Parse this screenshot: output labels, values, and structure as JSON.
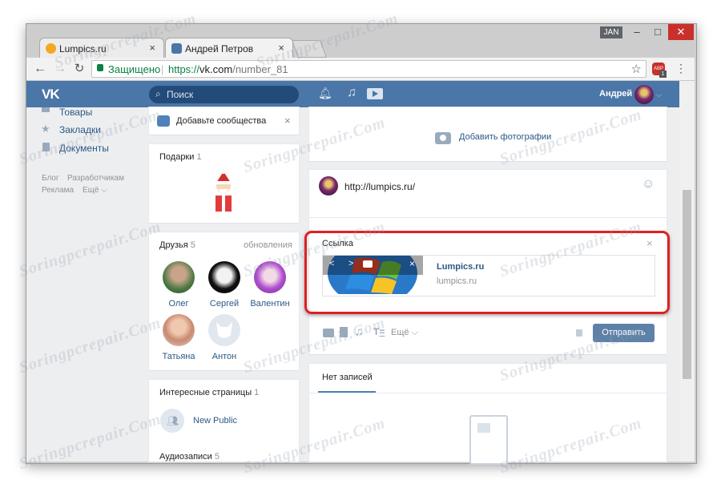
{
  "browser": {
    "tabs": [
      {
        "title": "Lumpics.ru",
        "close": "×"
      },
      {
        "title": "Андрей Петров",
        "close": "×"
      }
    ],
    "user_chip": "JAN",
    "window_controls": {
      "minimize": "–",
      "maximize": "□",
      "close": "✕"
    },
    "secure_label": "Защищено",
    "url_scheme": "https://",
    "url_host": "vk.com",
    "url_path": "/number_81",
    "ext_badge": "1",
    "ext_label": "ABP"
  },
  "vk": {
    "logo": "VK",
    "search_placeholder": "Поиск",
    "user_name": "Андрей",
    "left_menu": [
      {
        "label": "Товары"
      },
      {
        "label": "Закладки"
      },
      {
        "label": "Документы"
      }
    ],
    "footer_links": {
      "blog": "Блог",
      "dev": "Разработчикам",
      "ads": "Реклама",
      "more": "Ещё"
    },
    "add_communities": "Добавьте сообщества",
    "gifts": {
      "title": "Подарки",
      "count": "1"
    },
    "friends": {
      "title": "Друзья",
      "count": "5",
      "updates": "обновления",
      "list": [
        {
          "name": "Олег"
        },
        {
          "name": "Сергей"
        },
        {
          "name": "Валентин"
        },
        {
          "name": "Татьяна"
        },
        {
          "name": "Антон"
        }
      ]
    },
    "interesting": {
      "title": "Интересные страницы",
      "count": "1",
      "item": "New Public"
    },
    "audio": {
      "title": "Аудиозаписи",
      "count": "5"
    },
    "add_photos": "Добавить фотографии",
    "composer": {
      "text": "http://lumpics.ru/",
      "link_block_title": "Ссылка",
      "link_title": "Lumpics.ru",
      "link_domain": "lumpics.ru",
      "more": "Ещё",
      "send": "Отправить"
    },
    "no_posts": "Нет записей"
  },
  "watermark": "Soringpcrepair.Com",
  "colors": {
    "vk_blue": "#4a76a8",
    "link": "#2a5885",
    "highlight": "#e02020"
  }
}
